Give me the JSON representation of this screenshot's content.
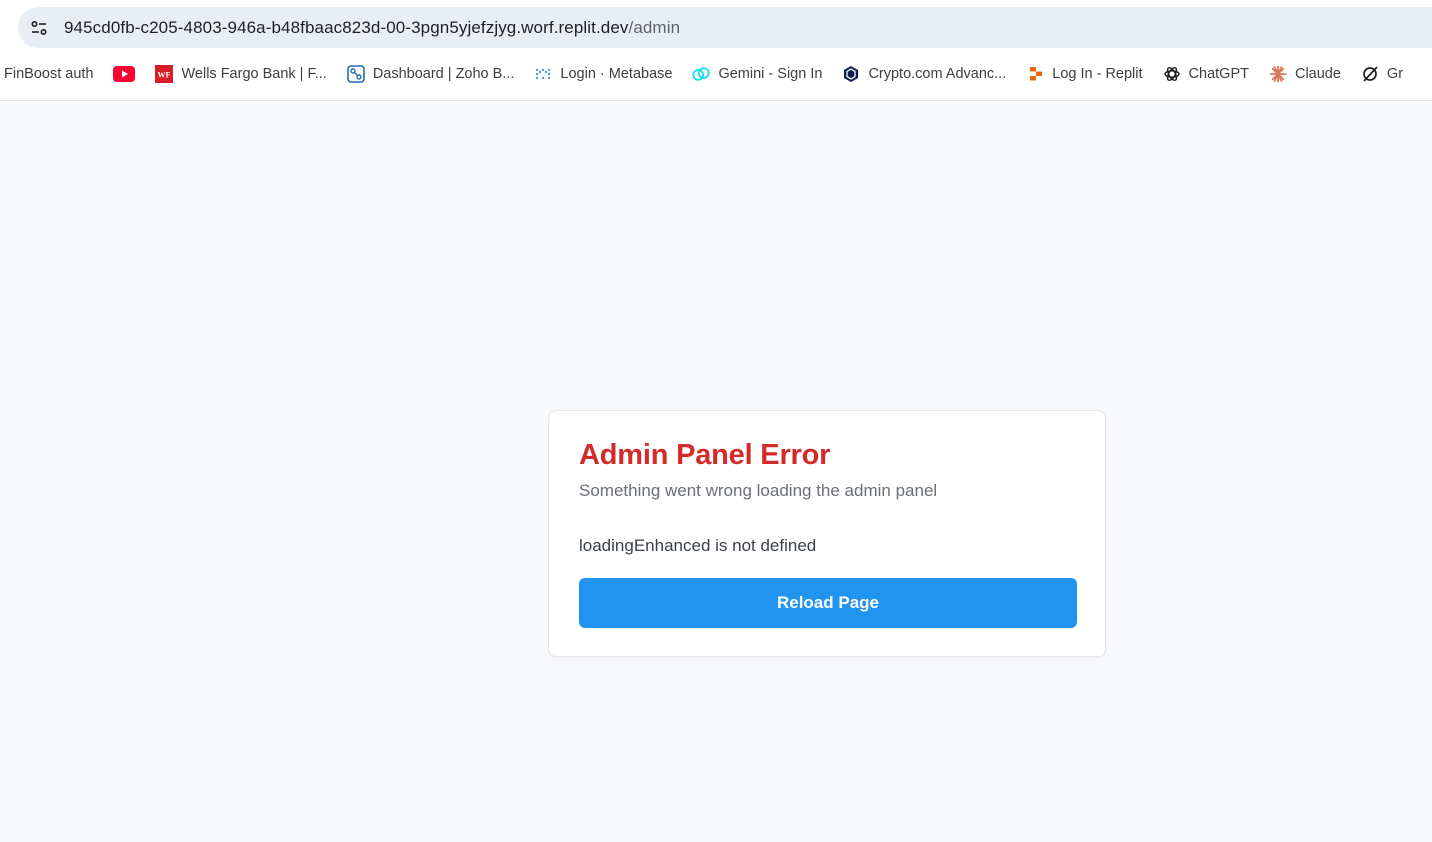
{
  "browser": {
    "url_host": "945cd0fb-c205-4803-946a-b48fbaac823d-00-3pgn5yjefzjyg.worf.replit.dev",
    "url_path": "/admin",
    "site_info_icon": "tune-icon"
  },
  "bookmarks": [
    {
      "label": "FinBoost auth",
      "icon": "none"
    },
    {
      "label": "",
      "icon": "youtube-icon"
    },
    {
      "label": "Wells Fargo Bank | F...",
      "icon": "wells-fargo-icon",
      "icon_text": "WF"
    },
    {
      "label": "Dashboard | Zoho B...",
      "icon": "zoho-icon"
    },
    {
      "label": "Login · Metabase",
      "icon": "metabase-icon"
    },
    {
      "label": "Gemini - Sign In",
      "icon": "gemini-icon"
    },
    {
      "label": "Crypto.com Advanc...",
      "icon": "crypto-com-icon"
    },
    {
      "label": "Log In - Replit",
      "icon": "replit-icon"
    },
    {
      "label": "ChatGPT",
      "icon": "chatgpt-icon"
    },
    {
      "label": "Claude",
      "icon": "claude-icon"
    },
    {
      "label": "Gr",
      "icon": "grok-icon"
    }
  ],
  "error_card": {
    "title": "Admin Panel Error",
    "subtitle": "Something went wrong loading the admin panel",
    "message": "loadingEnhanced is not defined",
    "button_label": "Reload Page"
  },
  "colors": {
    "error_title": "#d42a2a",
    "button_bg": "#2193f0",
    "page_bg": "#f8f9fb"
  }
}
